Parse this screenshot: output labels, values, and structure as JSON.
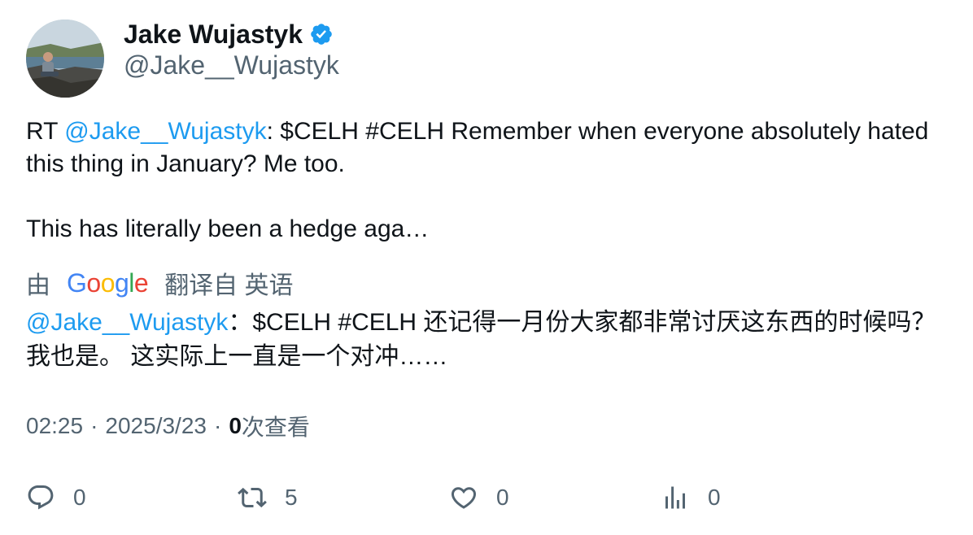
{
  "author": {
    "display_name": "Jake Wujastyk",
    "handle": "@Jake__Wujastyk",
    "verified_icon": "verified-badge-icon"
  },
  "tweet": {
    "prefix": "RT ",
    "mention": "@Jake__Wujastyk",
    "line1_rest": ": $CELH #CELH Remember when everyone absolutely hated this thing in January? Me too.",
    "line2": "This has literally been a hedge aga…"
  },
  "translation": {
    "by": "由",
    "google_letters": [
      "G",
      "o",
      "o",
      "g",
      "l",
      "e"
    ],
    "google_colors": [
      "#4285F4",
      "#EA4335",
      "#FBBC05",
      "#4285F4",
      "#34A853",
      "#EA4335"
    ],
    "translated_from": "翻译自 英语",
    "mention": "@Jake__Wujastyk",
    "text": "：$CELH #CELH 还记得一月份大家都非常讨厌这东西的时候吗？我也是。 这实际上一直是一个对冲……"
  },
  "meta": {
    "time": "02:25",
    "sep1": "·",
    "date": "2025/3/23",
    "sep2": "·",
    "views_count": "0",
    "views_label": "次查看"
  },
  "actions": {
    "reply_count": "0",
    "retweet_count": "5",
    "like_count": "0",
    "views_count": "0"
  },
  "colors": {
    "accent": "#1d9bf0",
    "muted": "#536471",
    "text": "#0f1419"
  }
}
